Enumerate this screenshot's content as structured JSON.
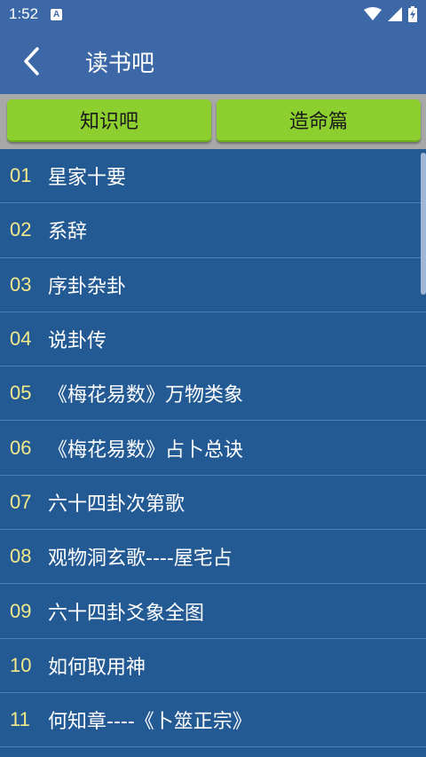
{
  "status_bar": {
    "time": "1:52",
    "notification_letter": "A"
  },
  "app_bar": {
    "title": "读书吧"
  },
  "tabs": [
    {
      "label": "知识吧"
    },
    {
      "label": "造命篇"
    }
  ],
  "list": [
    {
      "num": "01",
      "title": "星家十要"
    },
    {
      "num": "02",
      "title": "系辞"
    },
    {
      "num": "03",
      "title": "序卦杂卦"
    },
    {
      "num": "04",
      "title": "说卦传"
    },
    {
      "num": "05",
      "title": "《梅花易数》万物类象"
    },
    {
      "num": "06",
      "title": "《梅花易数》占卜总诀"
    },
    {
      "num": "07",
      "title": "六十四卦次第歌"
    },
    {
      "num": "08",
      "title": "观物洞玄歌----屋宅占"
    },
    {
      "num": "09",
      "title": "六十四卦爻象全图"
    },
    {
      "num": "10",
      "title": "如何取用神"
    },
    {
      "num": "11",
      "title": "何知章----《卜筮正宗》"
    }
  ],
  "colors": {
    "app_bar": "#3d68a8",
    "list_bg": "#245a94",
    "tab_green": "#8ccf2e",
    "number_yellow": "#f2e98a"
  }
}
